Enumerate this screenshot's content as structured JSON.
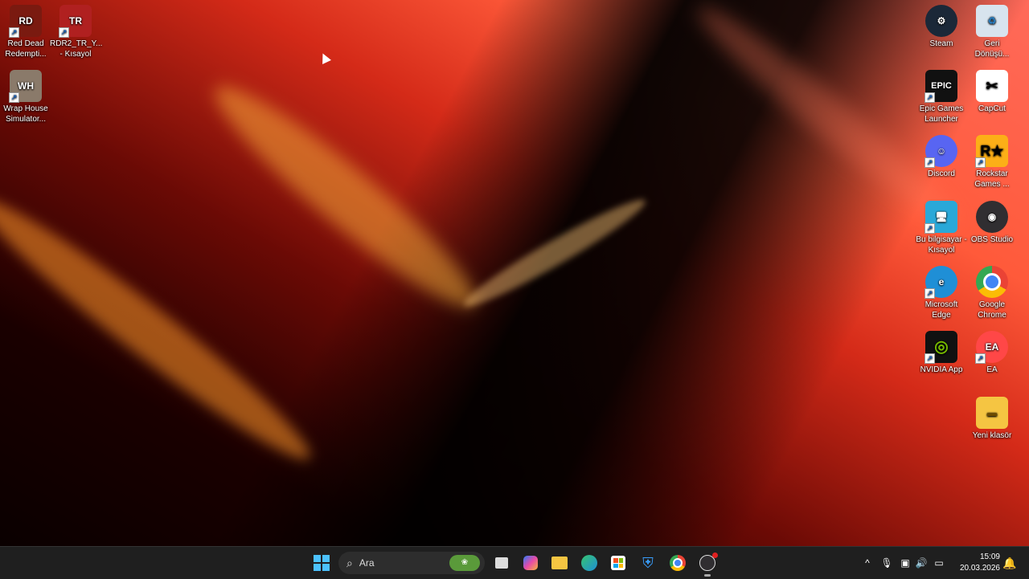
{
  "desktop": {
    "icons_left": [
      {
        "label": "Red Dead Redempti...",
        "icon": "red-dead-icon",
        "color": "#7a1a10"
      },
      {
        "label": "RDR2_TR_Y... - Kısayol",
        "icon": "rdr2-tr-icon",
        "color": "#b02020"
      },
      {
        "label": "Wrap House Simulator...",
        "icon": "wrap-house-icon",
        "color": "#8a7a6a"
      }
    ],
    "icons_right": [
      {
        "label": "Steam",
        "icon": "steam-icon",
        "color": "#1b2838"
      },
      {
        "label": "Geri Dönüşü...",
        "icon": "recycle-bin-icon",
        "color": "#d8e4ee"
      },
      {
        "label": "Epic Games Launcher",
        "icon": "epic-games-icon",
        "color": "#111111"
      },
      {
        "label": "CapCut",
        "icon": "capcut-icon",
        "color": "#ffffff"
      },
      {
        "label": "Discord",
        "icon": "discord-icon",
        "color": "#5865f2"
      },
      {
        "label": "Rockstar Games ...",
        "icon": "rockstar-icon",
        "color": "#fcaf17"
      },
      {
        "label": "Bu bilgisayar - Kısayol",
        "icon": "this-pc-icon",
        "color": "#2aa8d8"
      },
      {
        "label": "OBS Studio",
        "icon": "obs-icon",
        "color": "#302e31"
      },
      {
        "label": "Microsoft Edge",
        "icon": "edge-icon",
        "color": "#1f8fd6"
      },
      {
        "label": "Google Chrome",
        "icon": "chrome-icon",
        "color": "#4285f4"
      },
      {
        "label": "NVIDIA App",
        "icon": "nvidia-icon",
        "color": "#76b900"
      },
      {
        "label": "EA",
        "icon": "ea-icon",
        "color": "#ff4747"
      },
      {
        "label": "Yeni klasör",
        "icon": "folder-icon",
        "color": "#f5c542"
      }
    ]
  },
  "taskbar": {
    "search_placeholder": "Ara",
    "apps": [
      {
        "name": "start-button",
        "icon": "windows-icon"
      },
      {
        "name": "task-view-button",
        "icon": "task-view-icon"
      },
      {
        "name": "copilot-button",
        "icon": "copilot-icon"
      },
      {
        "name": "file-explorer-button",
        "icon": "file-explorer-icon"
      },
      {
        "name": "edge-taskbar-button",
        "icon": "edge-icon"
      },
      {
        "name": "store-button",
        "icon": "store-icon"
      },
      {
        "name": "defender-button",
        "icon": "shield-icon"
      },
      {
        "name": "chrome-taskbar-button",
        "icon": "chrome-icon"
      },
      {
        "name": "obs-taskbar-button",
        "icon": "obs-icon"
      }
    ],
    "time": "15:09",
    "date": "20.03.2026"
  },
  "colors": {
    "taskbar_bg": "#1f1f1f",
    "accent": "#0078d4"
  }
}
